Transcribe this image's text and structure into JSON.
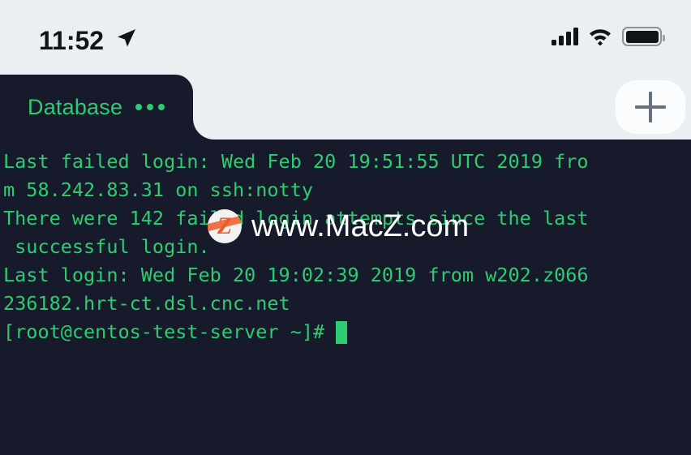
{
  "status_bar": {
    "time": "11:52",
    "location_icon": "location-arrow-icon",
    "signal_icon": "cellular-signal-icon",
    "signal_bars": 4,
    "wifi_icon": "wifi-icon",
    "battery_icon": "battery-full-icon",
    "battery_level": 100
  },
  "tab_bar": {
    "active_tab": {
      "label": "Database",
      "menu_icon": "ellipsis-icon"
    },
    "add_button": {
      "icon": "plus-icon",
      "label": "+"
    }
  },
  "terminal": {
    "background_color": "#171a2b",
    "text_color": "#2ecc71",
    "lines": [
      "Last failed login: Wed Feb 20 19:51:55 UTC 2019 fro",
      "m 58.242.83.31 on ssh:notty",
      "There were 142 failed login attempts since the last",
      " successful login.",
      "Last login: Wed Feb 20 19:02:39 2019 from w202.z066",
      "236182.hrt-ct.dsl.cnc.net"
    ],
    "prompt": "[root@centos-test-server ~]# ",
    "cursor_visible": true
  },
  "watermark": {
    "logo_letter": "Z",
    "text": "www.MacZ.com",
    "brand_color": "#f05a28"
  },
  "colors": {
    "page_background": "#eceff1",
    "terminal_background": "#171a2b",
    "terminal_green": "#2ecc71",
    "plus_gray": "#66717c"
  }
}
